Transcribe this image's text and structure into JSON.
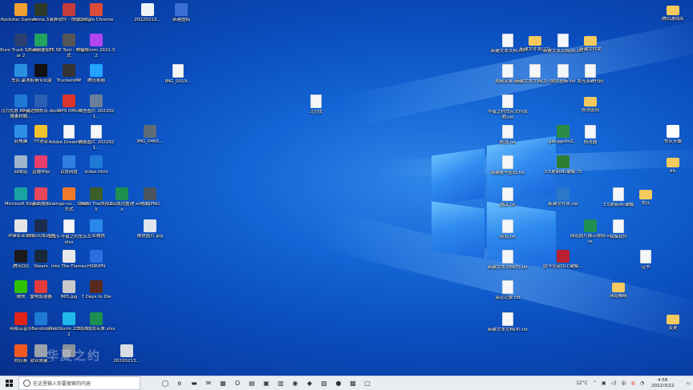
{
  "desktop": {
    "watermark": "华夏之约",
    "icons": [
      {
        "label": "Rockstar Games...",
        "glyph": "app",
        "color": "#f0a030"
      },
      {
        "label": "Arma 3",
        "glyph": "app",
        "color": "#2e3b2a"
      },
      {
        "label": "录屏软件 - 快捷方式",
        "glyph": "app",
        "color": "#c43c3c"
      },
      {
        "label": "Google Chrome",
        "glyph": "app",
        "color": "#dd4b39"
      },
      {
        "label": "20220213...",
        "glyph": "app",
        "color": "#eef2f6"
      },
      {
        "label": "新建图标",
        "glyph": "app",
        "color": "#3b6fd6"
      },
      {
        "label": "腾讯游戏库",
        "glyph": "folder",
        "color": "#f4c95d"
      },
      {
        "label": "Euro Truck Simulator 2",
        "glyph": "app",
        "color": "#2b3f73"
      },
      {
        "label": "大漠随便影件",
        "glyph": "app",
        "color": "#22a35f"
      },
      {
        "label": "TS SE Tool - 快捷方式",
        "glyph": "app",
        "color": "#555555"
      },
      {
        "label": "PhpStorm 2021.3.2",
        "glyph": "app",
        "color": "#b345f1"
      },
      {
        "label": "车队 副本",
        "glyph": "app",
        "color": "#2a8fe0"
      },
      {
        "label": "剪辑专业版",
        "glyph": "app",
        "color": "#111111"
      },
      {
        "label": "TruckersMP",
        "glyph": "app",
        "color": "#333333"
      },
      {
        "label": "腾讯视频",
        "glyph": "app",
        "color": "#23a3ff"
      },
      {
        "label": "IMG_0019...",
        "glyph": "doc",
        "color": "#f4f6f8"
      },
      {
        "label": "马力优惠 Boom代码搜素材精...",
        "glyph": "app",
        "color": "#1f7ad6"
      },
      {
        "label": "华夏之约车队.docx",
        "glyph": "app",
        "color": "#2b5fb4"
      },
      {
        "label": "WPS Office",
        "glyph": "app",
        "color": "#d9352c"
      },
      {
        "label": "微信图片 2022021...",
        "glyph": "app",
        "color": "#6a7f99"
      },
      {
        "label": "马力优",
        "glyph": "doc",
        "color": "#f4f6f8"
      },
      {
        "label": "此电脑",
        "glyph": "app",
        "color": "#2f8fe6"
      },
      {
        "label": "YY语音",
        "glyph": "app",
        "color": "#f2c12e"
      },
      {
        "label": "Adobe Dreamwe...",
        "glyph": "doc",
        "color": "#f4f6f8"
      },
      {
        "label": "微信图片 2022021...",
        "glyph": "doc",
        "color": "#f4f6f8"
      },
      {
        "label": "IMG_0465...",
        "glyph": "app",
        "color": "#5e6b78"
      },
      {
        "label": "回收站",
        "glyph": "app",
        "color": "#9db5cc"
      },
      {
        "label": "直播伴侣",
        "glyph": "app",
        "color": "#ea3f6c"
      },
      {
        "label": "百度网盘",
        "glyph": "app",
        "color": "#2f7fe0"
      },
      {
        "label": "index.html",
        "glyph": "app",
        "color": "#1f7ad6"
      },
      {
        "label": "Microsoft Edge",
        "glyph": "app",
        "color": "#1aa3a3"
      },
      {
        "label": "桌面搜索",
        "glyph": "app",
        "color": "#e8465b"
      },
      {
        "label": "xampp-co... - 快捷方式",
        "glyph": "app",
        "color": "#f07a2c"
      },
      {
        "label": "Grand Theft Auto V",
        "glyph": "app",
        "color": "#3c5f2a"
      },
      {
        "label": "3月1日成员整理.xlsx",
        "glyph": "xls",
        "color": "#1d8f4e"
      },
      {
        "label": "电脑JPNG",
        "glyph": "app",
        "color": "#4a5560"
      },
      {
        "label": "冲锋影业软件",
        "glyph": "app",
        "color": "#e6e6e6"
      },
      {
        "label": "网易UU加速器",
        "glyph": "app",
        "color": "#1d2b4f"
      },
      {
        "label": "2-15-华夏之约车队.xlsx",
        "glyph": "doc",
        "color": "#f4f6f8"
      },
      {
        "label": "企业微信",
        "glyph": "app",
        "color": "#2a89e8"
      },
      {
        "label": "微信图片.jpg",
        "glyph": "app",
        "color": "#e0e6ec"
      },
      {
        "label": "腾讯QQ",
        "glyph": "app",
        "color": "#1b1b1b"
      },
      {
        "label": "Steam",
        "glyph": "app",
        "color": "#1b2838"
      },
      {
        "label": "Into The Flames",
        "glyph": "app",
        "color": "#e8e8e8"
      },
      {
        "label": "HSRVPN",
        "glyph": "app",
        "color": "#2a6fe0"
      },
      {
        "label": "微信",
        "glyph": "app",
        "color": "#2dc100"
      },
      {
        "label": "雷电加速器",
        "glyph": "app",
        "color": "#e43b3b"
      },
      {
        "label": "865.jpg",
        "glyph": "app",
        "color": "#c9c9c9"
      },
      {
        "label": "7 Days to Die",
        "glyph": "app",
        "color": "#5a2a1f"
      },
      {
        "label": "网易云音乐",
        "glyph": "app",
        "color": "#e2231a"
      },
      {
        "label": "Bandizip",
        "glyph": "app",
        "color": "#1f7ad6"
      },
      {
        "label": "WebStorm 2021.3.2",
        "glyph": "app",
        "color": "#20b8e8"
      },
      {
        "label": "3月6成员名单.xlsx",
        "glyph": "xls",
        "color": "#1d8f4e"
      },
      {
        "label": "向日葵",
        "glyph": "app",
        "color": "#f05a22"
      },
      {
        "label": "就业质量...",
        "glyph": "app",
        "color": "#9aa3ad"
      },
      {
        "label": "",
        "glyph": "app",
        "color": "#8a9199"
      },
      {
        "label": "20220213...",
        "glyph": "app",
        "color": "#d8dde3"
      },
      {
        "label": "新建文本文档.txt",
        "glyph": "doc",
        "color": "#f4f6f8"
      },
      {
        "label": "新建文件夹(13)",
        "glyph": "folder",
        "color": "#f4c95d"
      },
      {
        "label": "新建文本文档(6).txt",
        "glyph": "doc",
        "color": "#f4f6f8"
      },
      {
        "label": "新建文件夹",
        "glyph": "folder",
        "color": "#f4c95d"
      },
      {
        "label": "视频名单.txt",
        "glyph": "doc",
        "color": "#f4f6f8"
      },
      {
        "label": "新建文本文档(2).txt",
        "glyph": "doc",
        "color": "#f4f6f8"
      },
      {
        "label": "文件图标.txt",
        "glyph": "doc",
        "color": "#f4f6f8"
      },
      {
        "label": "发光系统代码",
        "glyph": "doc",
        "color": "#f4f6f8"
      },
      {
        "label": "华夏之约车队文件说明.txt",
        "glyph": "doc",
        "color": "#f4f6f8"
      },
      {
        "label": "修改密码",
        "glyph": "folder",
        "color": "#f4c95d"
      },
      {
        "label": "刷钱.txt",
        "glyph": "doc",
        "color": "#f4f6f8"
      },
      {
        "label": "ganggolin2...",
        "glyph": "app",
        "color": "#2c8a46"
      },
      {
        "label": "修改器",
        "glyph": "doc",
        "color": "#f4f6f8"
      },
      {
        "label": "车队头像",
        "glyph": "app",
        "color": "#ffffff"
      },
      {
        "label": "新建账号密码.txt",
        "glyph": "doc",
        "color": "#f4f6f8"
      },
      {
        "label": "3.5更新dlc破解.7z",
        "glyph": "app",
        "color": "#2e7d32"
      },
      {
        "label": "dlc",
        "glyph": "folder",
        "color": "#f4c95d"
      },
      {
        "label": "测试.txt",
        "glyph": "doc",
        "color": "#f4f6f8"
      },
      {
        "label": "新建文件夹.zip",
        "glyph": "zip",
        "color": "#2b78c9"
      },
      {
        "label": "3.5更新dlc破解",
        "glyph": "doc",
        "color": "#f4f6f8"
      },
      {
        "label": "车队",
        "glyph": "folder",
        "color": "#f4c95d"
      },
      {
        "label": "网站.txt",
        "glyph": "doc",
        "color": "#f4f6f8"
      },
      {
        "label": "网站图片展示视频.xlsx",
        "glyph": "xls",
        "color": "#1d8f4e"
      },
      {
        "label": "镜像软件",
        "glyph": "doc",
        "color": "#f4f6f8"
      },
      {
        "label": "新建文本文档(5).txt",
        "glyph": "doc",
        "color": "#f4f6f8"
      },
      {
        "label": "欧卡全部DLC破解...",
        "glyph": "app",
        "color": "#b81f2f"
      },
      {
        "label": "证书",
        "glyph": "doc",
        "color": "#f4f6f8"
      },
      {
        "label": "会议记录.txt",
        "glyph": "doc",
        "color": "#f4f6f8"
      },
      {
        "label": "网站模板",
        "glyph": "folder",
        "color": "#f4c95d"
      },
      {
        "label": "新建文本文档(4).txt",
        "glyph": "doc",
        "color": "#f4f6f8"
      },
      {
        "label": "变更",
        "glyph": "folder",
        "color": "#f4c95d"
      }
    ]
  },
  "taskbar": {
    "search_placeholder": "在这里输入你要搜索的内容",
    "pinned": [
      {
        "name": "task-view",
        "symbol": "◯"
      },
      {
        "name": "edge",
        "symbol": "e"
      },
      {
        "name": "file-explorer",
        "symbol": "▬"
      },
      {
        "name": "mail",
        "symbol": "✉"
      },
      {
        "name": "calendar",
        "symbol": "▦"
      },
      {
        "name": "office",
        "symbol": "O"
      },
      {
        "name": "store",
        "symbol": "▤"
      },
      {
        "name": "truck-game",
        "symbol": "▣"
      },
      {
        "name": "screen-tool",
        "symbol": "▥"
      },
      {
        "name": "photos",
        "symbol": "◉"
      },
      {
        "name": "maps",
        "symbol": "◆"
      },
      {
        "name": "gallery",
        "symbol": "▨"
      },
      {
        "name": "yy",
        "symbol": "●"
      },
      {
        "name": "steam",
        "symbol": "▩"
      },
      {
        "name": "app-green",
        "symbol": "▢"
      }
    ],
    "weather": "12°C",
    "language": "中",
    "time": "4:58",
    "date": "2022/3/22"
  }
}
